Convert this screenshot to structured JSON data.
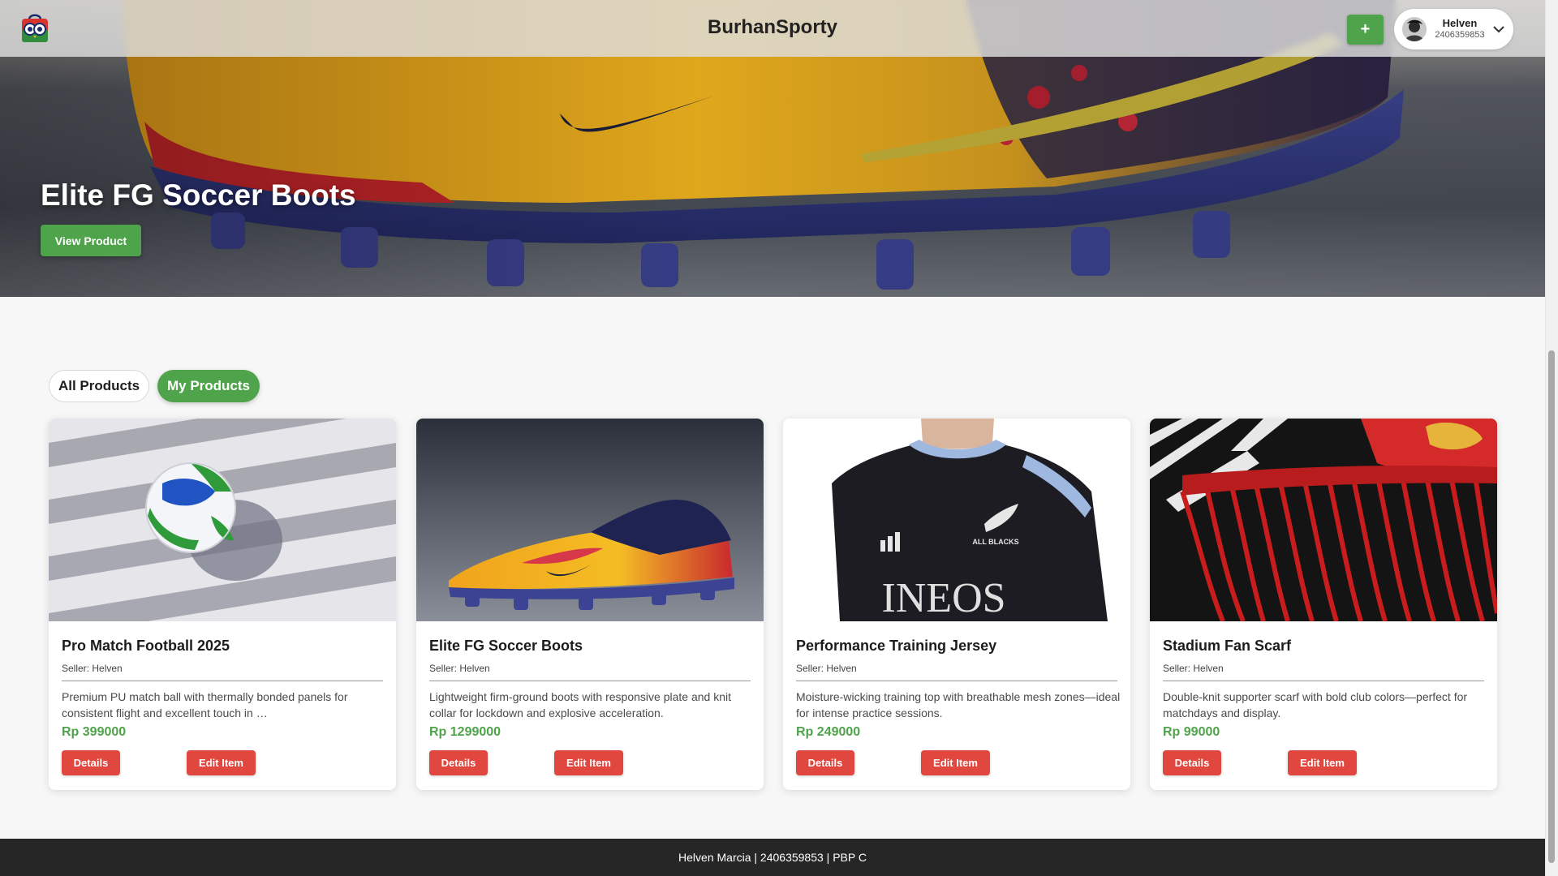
{
  "app": {
    "brand": "BurhanSporty",
    "add_label": "+",
    "user": {
      "name": "Helven",
      "id": "2406359853"
    }
  },
  "hero": {
    "title": "Elite FG Soccer Boots",
    "button_label": "View Product"
  },
  "tabs": [
    {
      "label": "All Products",
      "active": false
    },
    {
      "label": "My Products",
      "active": true
    }
  ],
  "products": [
    {
      "title": "Pro Match Football 2025",
      "seller": "Seller: Helven",
      "description": "Premium PU match ball with thermally bonded panels for consistent flight and excellent touch in …",
      "price": "Rp 399000",
      "details_label": "Details",
      "edit_label": "Edit Item"
    },
    {
      "title": "Elite FG Soccer Boots",
      "seller": "Seller: Helven",
      "description": "Lightweight firm-ground boots with responsive plate and knit collar for lockdown and explosive acceleration.",
      "price": "Rp 1299000",
      "details_label": "Details",
      "edit_label": "Edit Item"
    },
    {
      "title": "Performance Training Jersey",
      "seller": "Seller: Helven",
      "description": "Moisture-wicking training top with breathable mesh zones—ideal for intense practice sessions.",
      "price": "Rp 249000",
      "details_label": "Details",
      "edit_label": "Edit Item"
    },
    {
      "title": "Stadium Fan Scarf",
      "seller": "Seller: Helven",
      "description": "Double-knit supporter scarf with bold club colors—perfect for matchdays and display.",
      "price": "Rp 99000",
      "details_label": "Details",
      "edit_label": "Edit Item"
    }
  ],
  "image_text": {
    "jersey_sponsor": "INEOS",
    "jersey_badge": "ALL BLACKS"
  },
  "footer": {
    "text": "Helven Marcia | 2406359853 | PBP C"
  },
  "colors": {
    "accent_green": "#4fa34a",
    "danger_red": "#e2473f",
    "footer_bg": "#262626"
  }
}
